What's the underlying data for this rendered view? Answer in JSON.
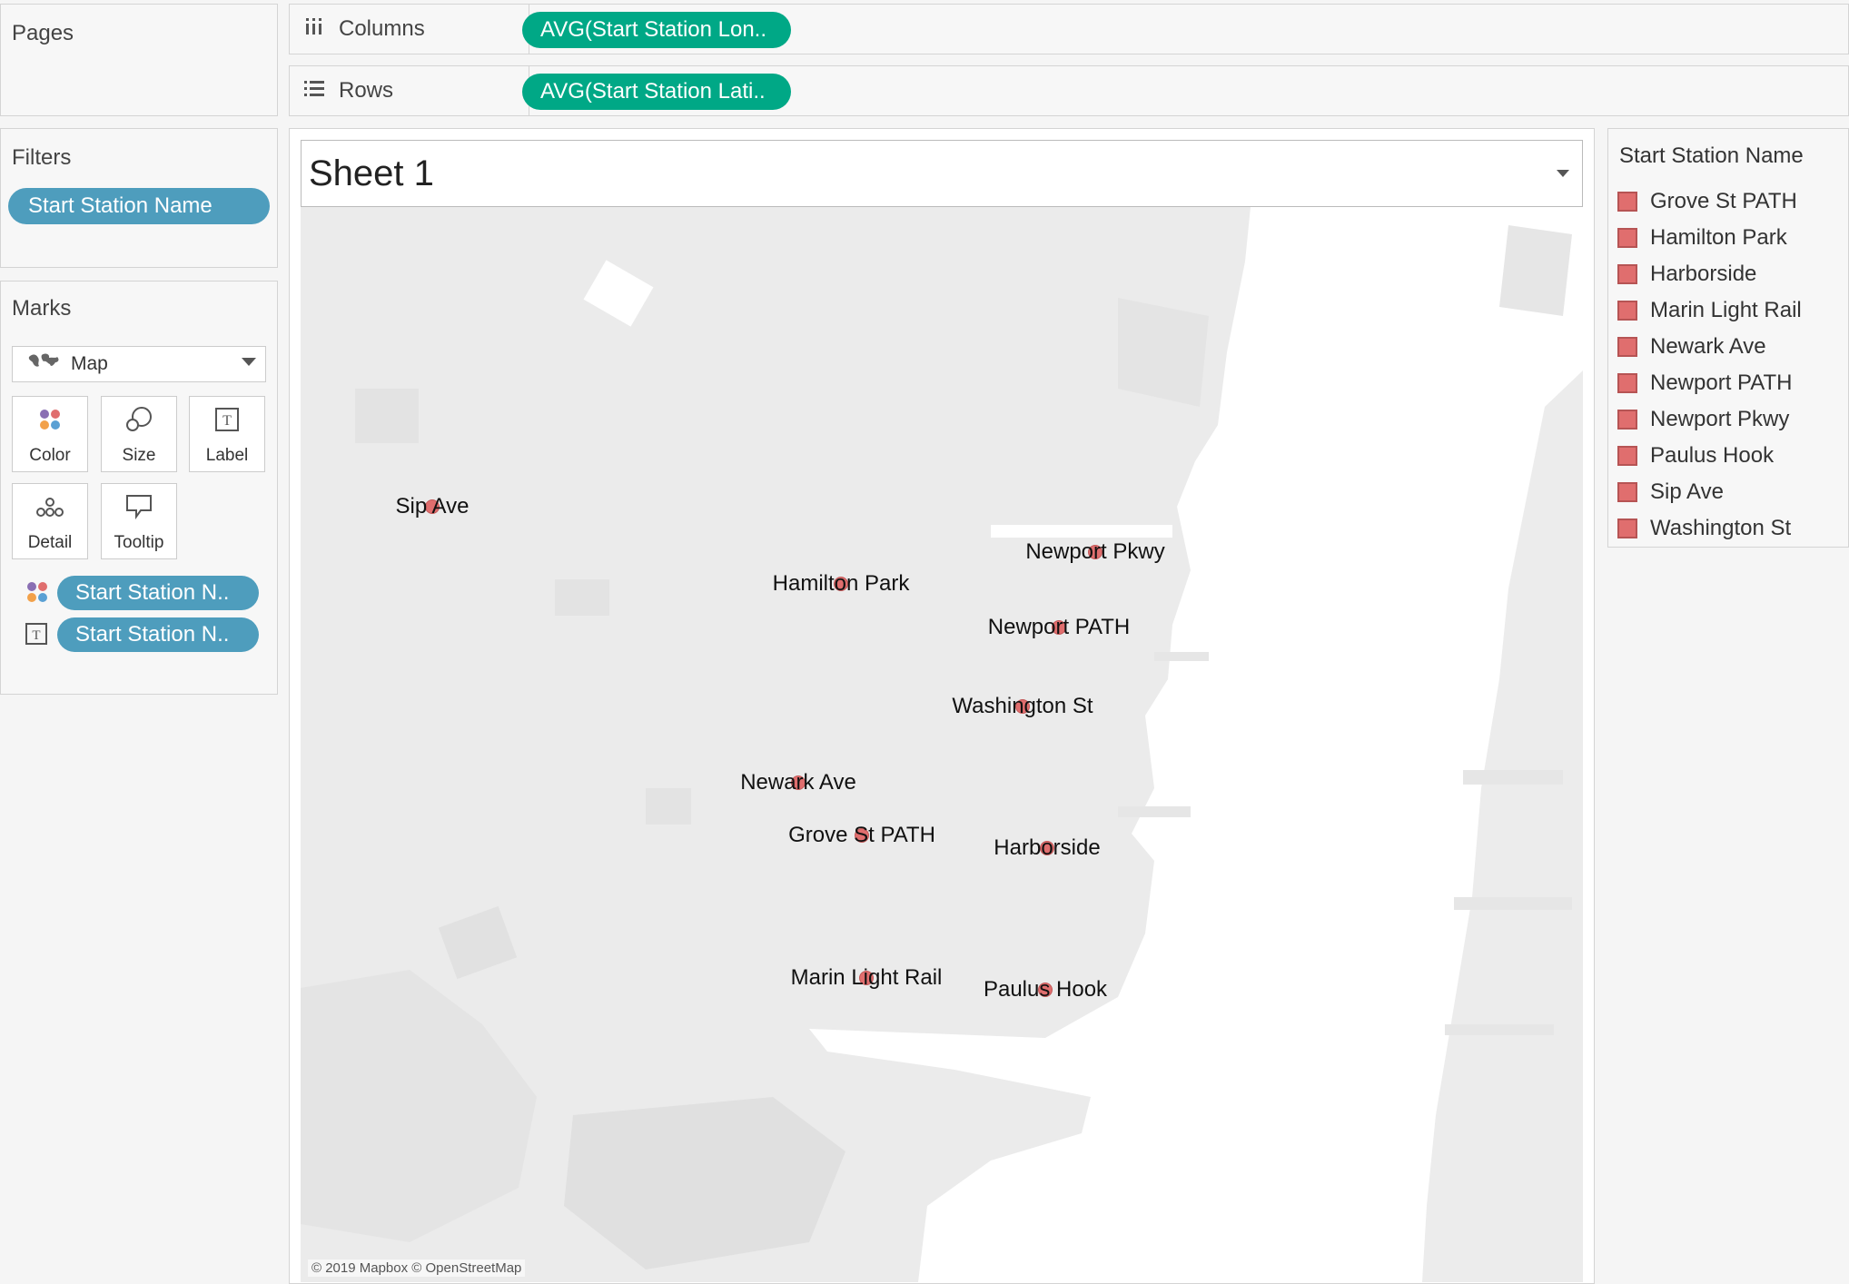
{
  "pages": {
    "title": "Pages"
  },
  "filters": {
    "title": "Filters",
    "pill": "Start Station Name"
  },
  "marks": {
    "title": "Marks",
    "mark_type": "Map",
    "buttons": {
      "color": "Color",
      "size": "Size",
      "label": "Label",
      "detail": "Detail",
      "tooltip": "Tooltip"
    },
    "fields": [
      "Start Station N..",
      "Start Station N.."
    ]
  },
  "shelves": {
    "columns": {
      "label": "Columns",
      "pill": "AVG(Start Station Lon.."
    },
    "rows": {
      "label": "Rows",
      "pill": "AVG(Start Station Lati.."
    }
  },
  "sheet": {
    "title": "Sheet 1"
  },
  "legend": {
    "title": "Start Station Name",
    "color": "#e06e6e",
    "items": [
      "Grove St PATH",
      "Hamilton Park",
      "Harborside",
      "Marin Light Rail",
      "Newark Ave",
      "Newport PATH",
      "Newport Pkwy",
      "Paulus Hook",
      "Sip Ave",
      "Washington St"
    ]
  },
  "map": {
    "attribution": "© 2019 Mapbox © OpenStreetMap",
    "stations": [
      "Sip Ave",
      "Newport Pkwy",
      "Hamilton Park",
      "Newport PATH",
      "Washington St",
      "Newark Ave",
      "Grove St PATH",
      "Harborside",
      "Marin Light Rail",
      "Paulus Hook"
    ]
  },
  "colors": {
    "pill_blue": "#4e9dbd",
    "pill_green": "#00a886",
    "mark": "#e06e6e"
  }
}
